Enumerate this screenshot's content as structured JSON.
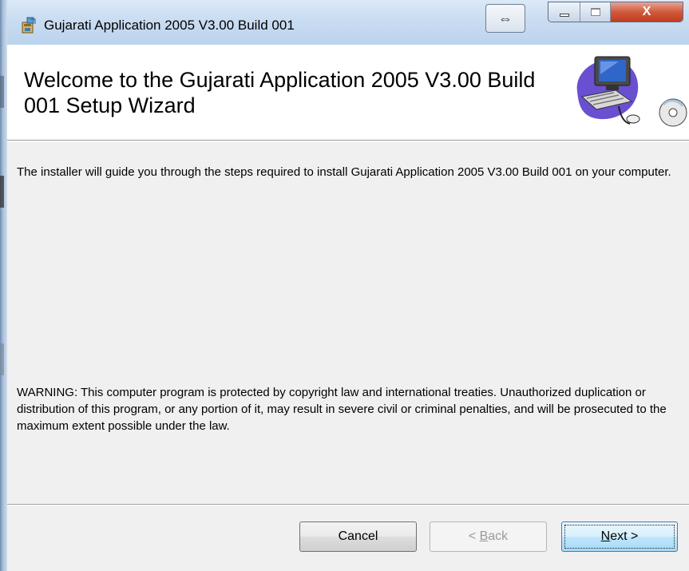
{
  "window": {
    "title": "Gujarati Application 2005 V3.00 Build 001",
    "icons": {
      "app": "installer-package-icon",
      "resize": "resize-arrows-icon",
      "minimize": "minimize-icon",
      "maximize": "maximize-icon",
      "close": "close-icon"
    },
    "resize_glyph": "⇔",
    "close_glyph": "X"
  },
  "header": {
    "title": "Welcome to the Gujarati Application 2005 V3.00 Build 001 Setup Wizard",
    "graphic": "computer-setup-graphic"
  },
  "body": {
    "intro": "The installer will guide you through the steps required to install Gujarati Application 2005 V3.00 Build 001 on your computer.",
    "warning": "WARNING: This computer program is protected by copyright law and international treaties. Unauthorized duplication or distribution of this program, or any portion of it, may result in severe civil or criminal penalties, and will be prosecuted to the maximum extent possible under the law."
  },
  "buttons": {
    "cancel": "Cancel",
    "back_prefix": "< ",
    "back_accel": "B",
    "back_rest": "ack",
    "next_accel": "N",
    "next_rest": "ext >"
  },
  "colors": {
    "titlebar": "#c9dcf1",
    "close": "#c13c1e",
    "dialog_bg": "#f0f0f0",
    "next_focus_border": "#3c7fb1"
  }
}
